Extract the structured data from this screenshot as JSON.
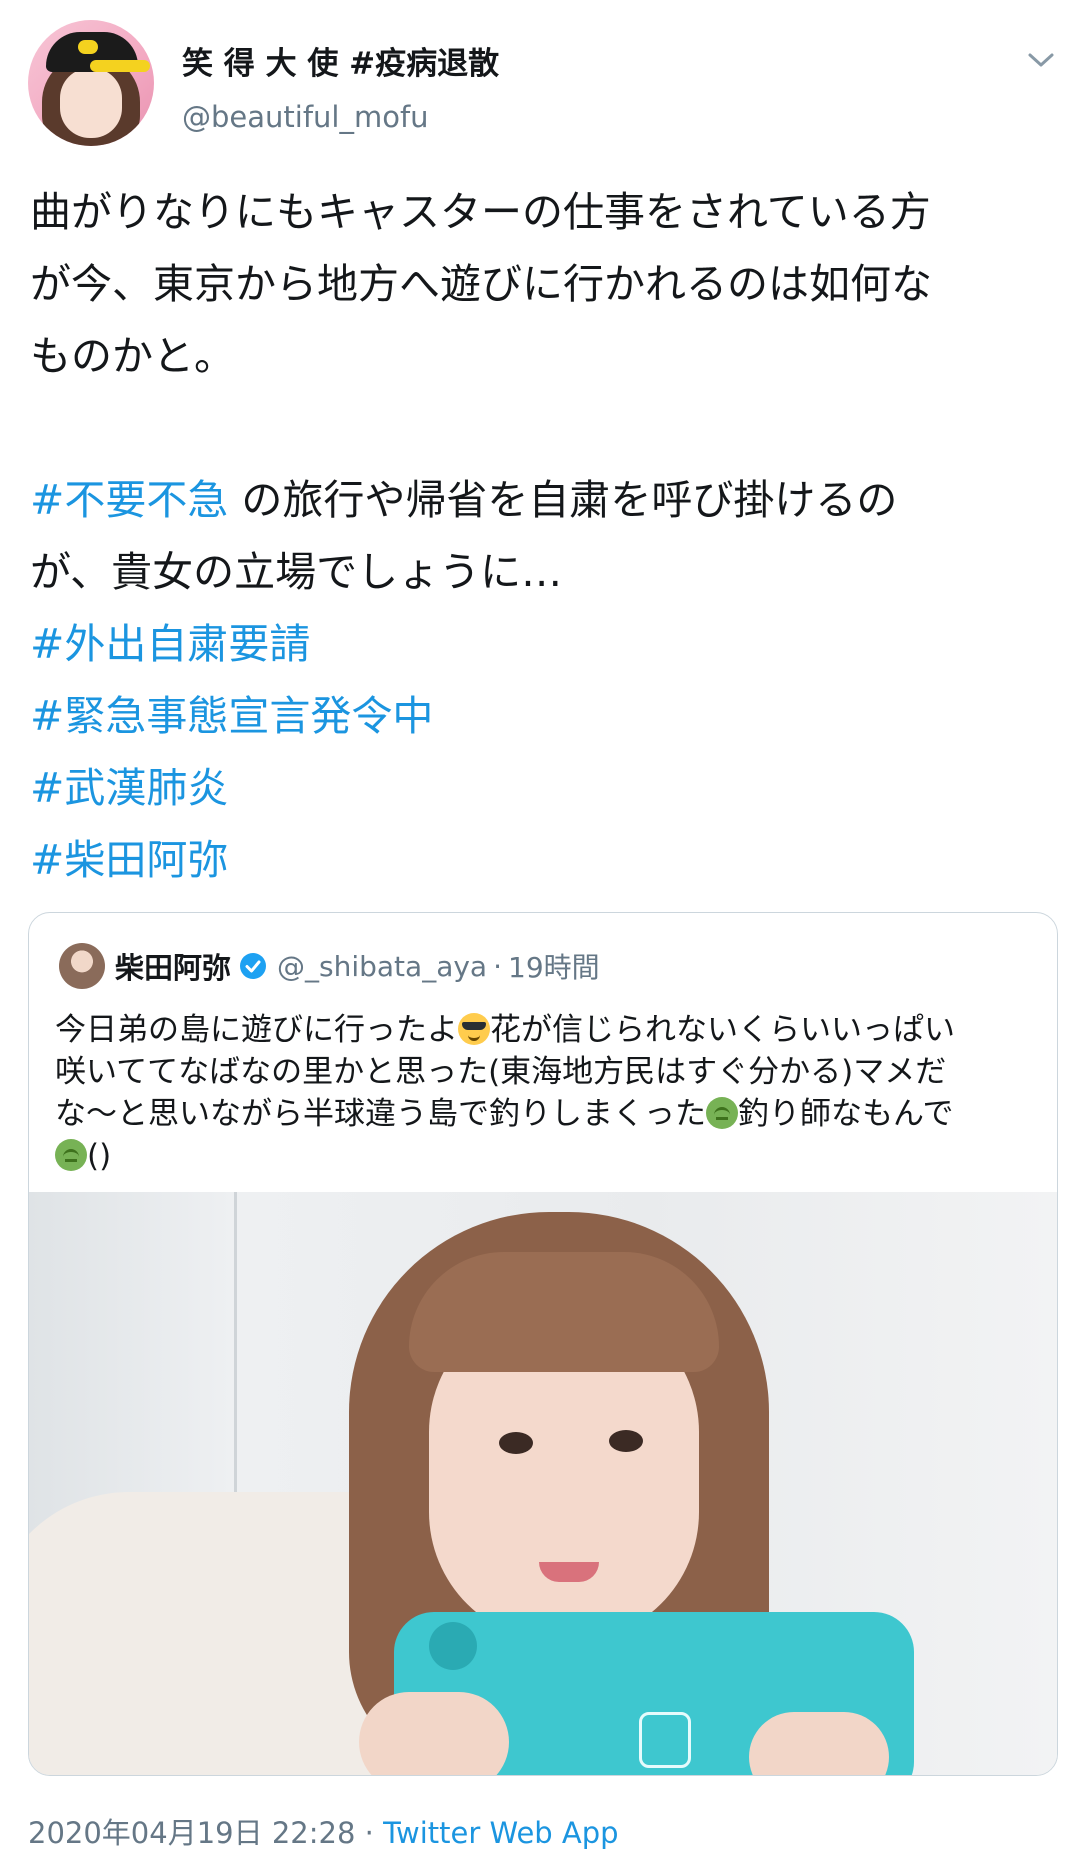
{
  "author": {
    "display_name": "笑 得 大 使 #疫病退散",
    "handle": "@beautiful_mofu"
  },
  "tweet": {
    "lines": [
      "曲がりなりにもキャスターの仕事をされている方",
      "が今、東京から地方へ遊びに行かれるのは如何な",
      "ものかと。"
    ],
    "hashtag_inline": "#不要不急",
    "line_after_hashtag": " の旅行や帰省を自粛を呼び掛けるの",
    "line_continued": "が、貴女の立場でしょうに…",
    "hashtags": [
      "#外出自粛要請",
      "#緊急事態宣言発令中",
      "#武漢肺炎",
      "#柴田阿弥"
    ]
  },
  "quoted_tweet": {
    "name": "柴田阿弥",
    "handle": "@_shibata_aya",
    "separator": "·",
    "time": "19時間",
    "line1_a": "今日弟の島に遊びに行ったよ",
    "line1_b": "花が信じられないくらいいっぱい",
    "line2": "咲いててなばなの里かと思った(東海地方民はすぐ分かる)マメだ",
    "line3_a": "な〜と思いながら半球違う島で釣りしまくった",
    "line3_b": "釣り師なもんで",
    "line4": "()",
    "emoji": {
      "cool": "smiling-face-with-sunglasses",
      "sick": "nauseated-face"
    }
  },
  "footer": {
    "timestamp": "2020年04月19日 22:28",
    "separator": "·",
    "app": "Twitter Web App"
  },
  "colors": {
    "text": "#14171a",
    "secondary": "#657786",
    "link": "#1b95e0",
    "border": "#ccd6dd",
    "verified": "#1da1f2"
  }
}
